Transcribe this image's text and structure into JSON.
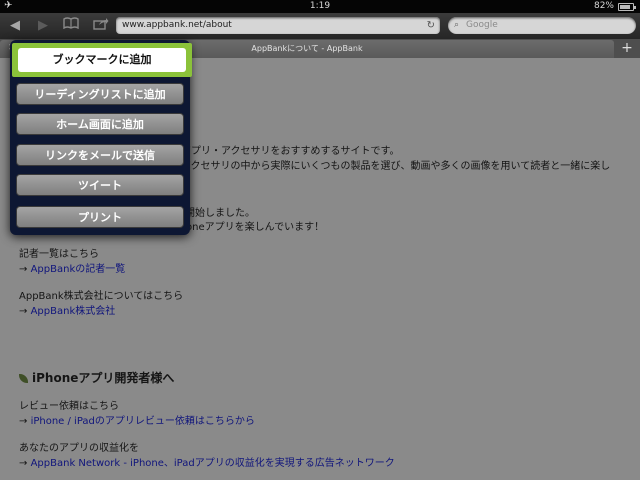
{
  "status": {
    "time": "1:19",
    "battery": "82%",
    "airplane_icon": "airplane-icon"
  },
  "toolbar": {
    "url": "www.appbank.net/about",
    "search_placeholder": "Google"
  },
  "tabs": [
    {
      "title": "AppBankについて - AppBank"
    }
  ],
  "menu": {
    "items": [
      "ブックマークに追加",
      "リーディングリストに追加",
      "ホーム画面に追加",
      "リンクをメールで送信",
      "ツイート",
      "プリント"
    ]
  },
  "page": {
    "p1": "アプリ・アクセサリをおすすめするサイトです。",
    "p2": "アクセサリの中から実際にいくつもの製品を選び、動画や多くの画像を用いて読者と一緒に楽し",
    "p3": "開始しました。",
    "p4": "oneアプリを楽しんでいます！",
    "writers_label": "記者一覧はこちら",
    "writers_link": "AppBankの記者一覧",
    "company_label": "AppBank株式会社についてはこちら",
    "company_link": "AppBank株式会社",
    "dev_heading": "iPhoneアプリ開発者様へ",
    "review_label": "レビュー依頼はこちら",
    "review_link": "iPhone / iPadのアプリレビュー依頼はこちらから",
    "monetize_label": "あなたのアプリの収益化を",
    "monetize_link": "AppBank Network - iPhone、iPadアプリの収益化を実現する広告ネットワーク",
    "arrow": "→"
  }
}
